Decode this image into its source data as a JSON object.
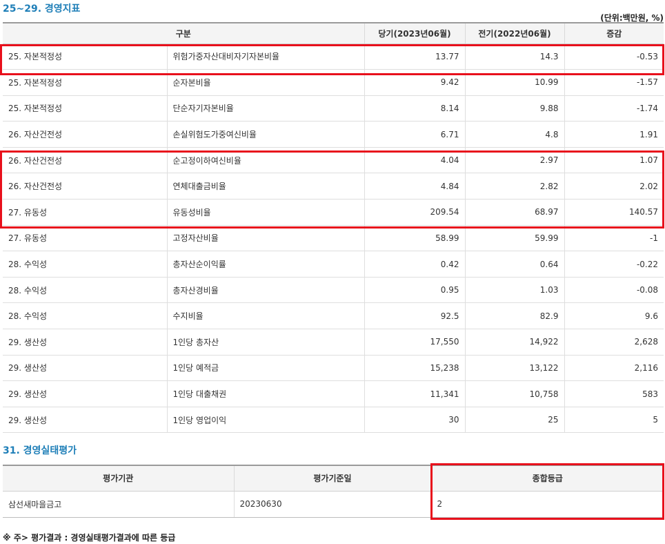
{
  "section1": {
    "title": "25~29. 경영지표",
    "unit_note": "(단위:백만원, %)",
    "headers": [
      "구분",
      "당기(2023년06월)",
      "전기(2022년06월)",
      "증감"
    ],
    "rows": [
      {
        "category": "25. 자본적정성",
        "item": "위험가중자산대비자기자본비율",
        "current": "13.77",
        "previous": "14.3",
        "change": "-0.53"
      },
      {
        "category": "25. 자본적정성",
        "item": "순자본비율",
        "current": "9.42",
        "previous": "10.99",
        "change": "-1.57"
      },
      {
        "category": "25. 자본적정성",
        "item": "단순자기자본비율",
        "current": "8.14",
        "previous": "9.88",
        "change": "-1.74"
      },
      {
        "category": "26. 자산건전성",
        "item": "손실위험도가중여신비율",
        "current": "6.71",
        "previous": "4.8",
        "change": "1.91"
      },
      {
        "category": "26. 자산건전성",
        "item": "순고정이하여신비율",
        "current": "4.04",
        "previous": "2.97",
        "change": "1.07"
      },
      {
        "category": "26. 자산건전성",
        "item": "연체대출금비율",
        "current": "4.84",
        "previous": "2.82",
        "change": "2.02"
      },
      {
        "category": "27. 유동성",
        "item": "유동성비율",
        "current": "209.54",
        "previous": "68.97",
        "change": "140.57"
      },
      {
        "category": "27. 유동성",
        "item": "고정자산비율",
        "current": "58.99",
        "previous": "59.99",
        "change": "-1"
      },
      {
        "category": "28. 수익성",
        "item": "총자산순이익률",
        "current": "0.42",
        "previous": "0.64",
        "change": "-0.22"
      },
      {
        "category": "28. 수익성",
        "item": "총자산경비율",
        "current": "0.95",
        "previous": "1.03",
        "change": "-0.08"
      },
      {
        "category": "28. 수익성",
        "item": "수지비율",
        "current": "92.5",
        "previous": "82.9",
        "change": "9.6"
      },
      {
        "category": "29. 생산성",
        "item": "1인당 총자산",
        "current": "17,550",
        "previous": "14,922",
        "change": "2,628"
      },
      {
        "category": "29. 생산성",
        "item": "1인당 예적금",
        "current": "15,238",
        "previous": "13,122",
        "change": "2,116"
      },
      {
        "category": "29. 생산성",
        "item": "1인당 대출채권",
        "current": "11,341",
        "previous": "10,758",
        "change": "583"
      },
      {
        "category": "29. 생산성",
        "item": "1인당 영업이익",
        "current": "30",
        "previous": "25",
        "change": "5"
      }
    ]
  },
  "section2": {
    "title": "31. 경영실태평가",
    "headers": [
      "평가기관",
      "평가기준일",
      "종합등급"
    ],
    "row": {
      "agency": "삼선새마을금고",
      "base_date": "20230630",
      "grade": "2"
    }
  },
  "footnote": "※ 주> 평가결과 : 경영실태평가결과에 따른 등급",
  "highlight_color": "#e8101c"
}
